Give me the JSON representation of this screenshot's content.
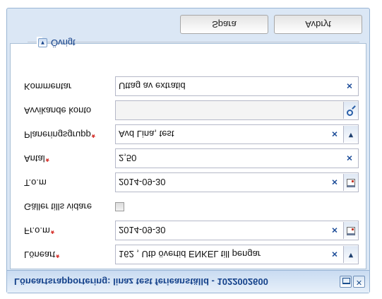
{
  "window": {
    "title": "Löneartsrapportering: linaz test ferieanställd - 1022002600",
    "controls": [
      "maximize-icon",
      "close-icon"
    ]
  },
  "form": {
    "rows": [
      {
        "label": "Löneart",
        "required": true,
        "value": "162 , Utb övertid ENKEL till pengar",
        "kind": "combo"
      },
      {
        "label": "Fr.o.m",
        "required": true,
        "value": "2014-09-30",
        "kind": "date"
      },
      {
        "label": "Gäller tills vidare",
        "required": false,
        "value": "",
        "checked": false,
        "kind": "checkbox"
      },
      {
        "label": "T.o.m",
        "required": false,
        "value": "2014-09-30",
        "kind": "date"
      },
      {
        "label": "Antal",
        "required": true,
        "value": "2,50",
        "kind": "text"
      },
      {
        "label": "Planeringsgrupp",
        "required": true,
        "value": "Avd Lina, test",
        "kind": "combo"
      },
      {
        "label": "Avvikande konto",
        "required": false,
        "value": "",
        "kind": "search"
      },
      {
        "label": "Kommentar",
        "required": false,
        "value": "Uttag av extratid",
        "kind": "text"
      }
    ],
    "required_marker": "*",
    "fieldset": {
      "label": "Övrigt",
      "collapsed": false
    }
  },
  "buttons": {
    "save": "Spara",
    "cancel": "Avbryt"
  },
  "colors": {
    "title_text": "#15428b",
    "required_marker": "#d3231d",
    "clear_icon": "#1f4e99",
    "frame": "#dbe7f5"
  }
}
